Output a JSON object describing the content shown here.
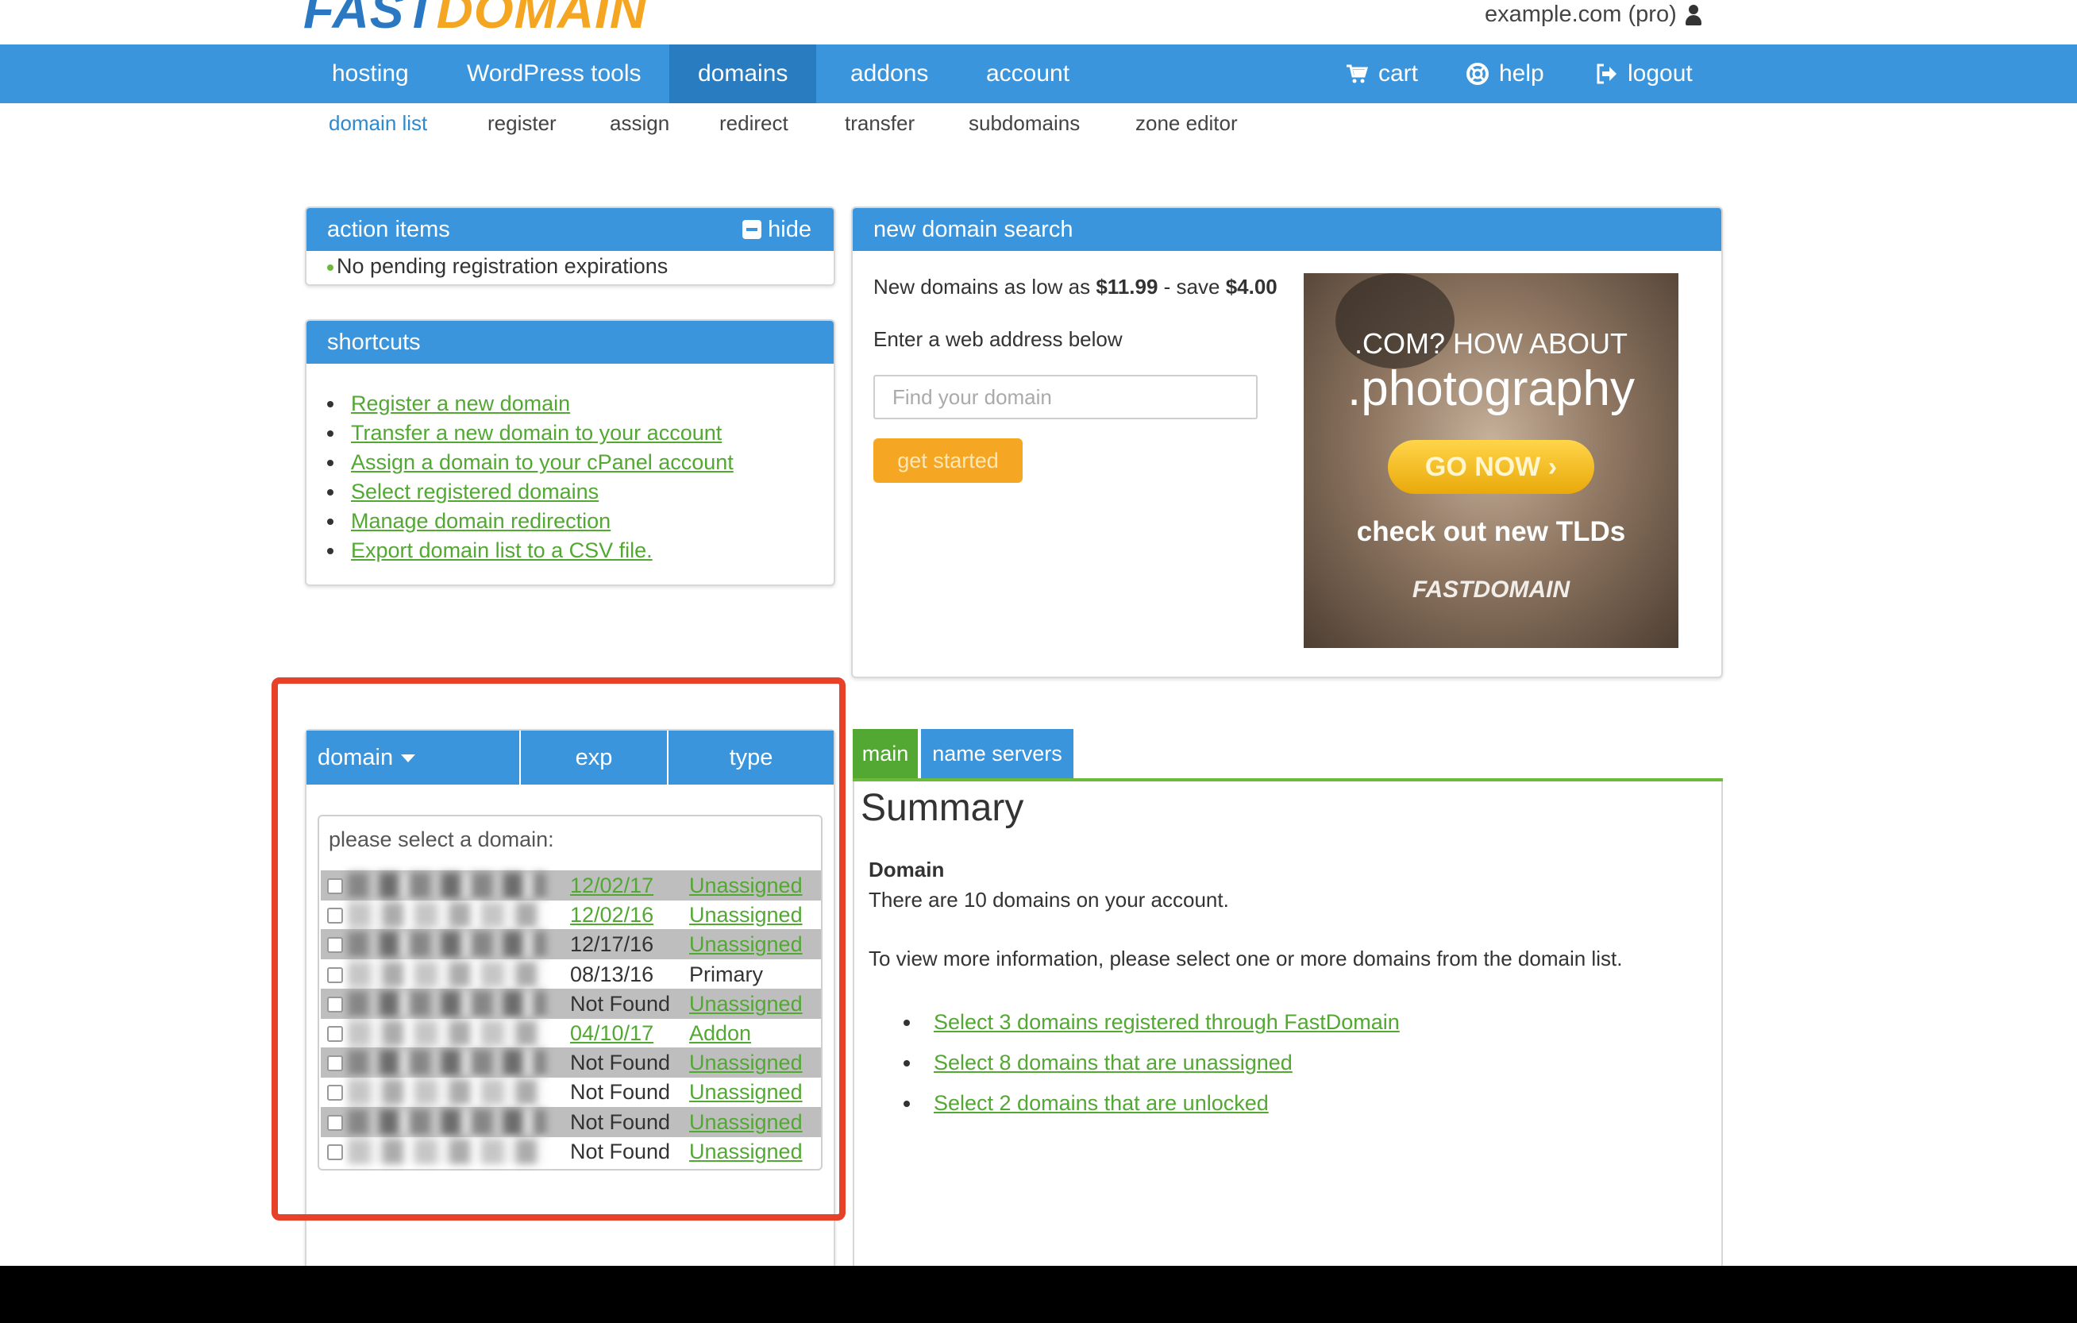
{
  "header": {
    "logo_text_a": "FAST",
    "logo_text_b": "DOMAIN",
    "account_label": "example.com (pro)",
    "account_icon": "user-icon"
  },
  "nav": {
    "items": [
      "hosting",
      "WordPress tools",
      "domains",
      "addons",
      "account"
    ],
    "active": "domains",
    "cart": "cart",
    "help": "help",
    "logout": "logout"
  },
  "subnav": {
    "items": [
      "domain list",
      "register",
      "assign",
      "redirect",
      "transfer",
      "subdomains",
      "zone editor"
    ],
    "active": "domain list"
  },
  "action_items": {
    "title": "action items",
    "hide_label": "hide",
    "message": "No pending registration expirations"
  },
  "shortcuts": {
    "title": "shortcuts",
    "links": [
      "Register a new domain",
      "Transfer a new domain to your account",
      "Assign a domain to your cPanel account",
      "Select registered domains",
      "Manage domain redirection",
      "Export domain list to a CSV file."
    ]
  },
  "domain_search": {
    "title": "new domain search",
    "promo_prefix": "New domains as low as ",
    "promo_price": "$11.99",
    "promo_mid": " - save ",
    "promo_save": "$4.00",
    "prompt": "Enter a web address below",
    "placeholder": "Find your domain",
    "button": "get started",
    "ad": {
      "line1": ".COM? HOW ABOUT",
      "line2": ".photography",
      "button": "GO NOW ›",
      "line3": "check out new TLDs",
      "brand": "FASTDOMAIN"
    }
  },
  "domain_table": {
    "columns": [
      "domain",
      "exp",
      "type"
    ],
    "select_label": "please select a domain:",
    "rows": [
      {
        "exp": "12/02/17",
        "type": "Unassigned",
        "exp_link": true,
        "type_link": true
      },
      {
        "exp": "12/02/16",
        "type": "Unassigned",
        "exp_link": true,
        "type_link": true
      },
      {
        "exp": "12/17/16",
        "type": "Unassigned",
        "exp_link": false,
        "type_link": true
      },
      {
        "exp": "08/13/16",
        "type": "Primary",
        "exp_link": false,
        "type_link": false
      },
      {
        "exp": "Not Found",
        "type": "Unassigned",
        "exp_link": false,
        "type_link": true
      },
      {
        "exp": "04/10/17",
        "type": "Addon",
        "exp_link": true,
        "type_link": true
      },
      {
        "exp": "Not Found",
        "type": "Unassigned",
        "exp_link": false,
        "type_link": true
      },
      {
        "exp": "Not Found",
        "type": "Unassigned",
        "exp_link": false,
        "type_link": true
      },
      {
        "exp": "Not Found",
        "type": "Unassigned",
        "exp_link": false,
        "type_link": true
      },
      {
        "exp": "Not Found",
        "type": "Unassigned",
        "exp_link": false,
        "type_link": true
      }
    ]
  },
  "summary": {
    "tabs": [
      "main",
      "name servers"
    ],
    "title": "Summary",
    "domain_heading": "Domain",
    "count_text": "There are 10 domains on your account.",
    "instructions": "To view more information, please select one or more domains from the domain list.",
    "links": [
      "Select 3 domains registered through FastDomain",
      "Select 8 domains that are unassigned",
      "Select 2 domains that are unlocked"
    ]
  },
  "colors": {
    "nav_blue": "#3b95dc",
    "nav_active": "#2a7cc0",
    "link_green": "#52a832",
    "button_orange": "#f5a623",
    "highlight_red": "#e8412a"
  }
}
